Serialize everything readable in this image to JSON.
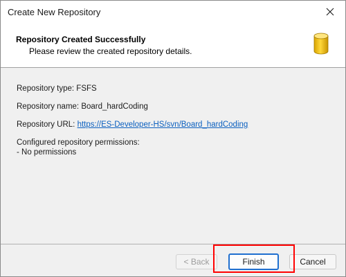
{
  "window": {
    "title": "Create New Repository"
  },
  "header": {
    "title": "Repository Created Successfully",
    "subtitle": "Please review the created repository details."
  },
  "details": {
    "type_label": "Repository type: FSFS",
    "name_label": "Repository name: Board_hardCoding",
    "url_prefix": "Repository URL: ",
    "url_value": "https://ES-Developer-HS/svn/Board_hardCoding",
    "permissions_heading": "Configured repository permissions:",
    "permissions_value": "- No permissions"
  },
  "buttons": {
    "back": "< Back",
    "finish": "Finish",
    "cancel": "Cancel"
  },
  "colors": {
    "accent": "#1f6fcf",
    "link": "#0a5fbf",
    "highlight": "#ff0000",
    "db_icon": "#f2c200"
  },
  "icons": [
    "close-icon",
    "database-icon"
  ]
}
